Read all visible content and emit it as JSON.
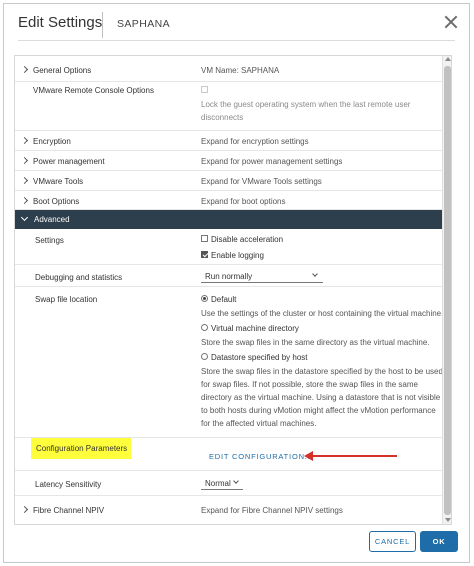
{
  "dialog": {
    "title": "Edit Settings",
    "vm_name": "SAPHANA"
  },
  "rows": {
    "general": {
      "label": "General Options",
      "value": "VM Name: SAPHANA"
    },
    "vmrc": {
      "label": "VMware Remote Console Options",
      "value_line1": "Lock the guest operating system when the last remote user",
      "value_line2": "disconnects"
    },
    "encryption": {
      "label": "Encryption",
      "value": "Expand for encryption settings"
    },
    "power": {
      "label": "Power management",
      "value": "Expand for power management settings"
    },
    "tools": {
      "label": "VMware Tools",
      "value": "Expand for VMware Tools settings"
    },
    "boot": {
      "label": "Boot Options",
      "value": "Expand for boot options"
    }
  },
  "advanced": {
    "label": "Advanced",
    "settings_label": "Settings",
    "disable_acceleration": "Disable acceleration",
    "enable_logging": "Enable logging",
    "debugging_label": "Debugging and statistics",
    "debugging_value": "Run normally",
    "swap_label": "Swap file location",
    "swap_default": "Default",
    "swap_default_desc": "Use the settings of the cluster or host containing the virtual machine.",
    "swap_vmdir": "Virtual machine directory",
    "swap_vmdir_desc": "Store the swap files in the same directory as the virtual machine.",
    "swap_datastore": "Datastore specified by host",
    "swap_ds_line1": "Store the swap files in the datastore specified by the host to be used",
    "swap_ds_line2": "for swap files. If not possible, store the swap files in the same",
    "swap_ds_line3": "directory as the virtual machine. Using a datastore that is not visible",
    "swap_ds_line4": "to both hosts during vMotion might affect the vMotion performance",
    "swap_ds_line5": "for the affected virtual machines.",
    "config_params_label": "Configuration Parameters",
    "edit_configuration": "EDIT CONFIGURATION...",
    "latency_label": "Latency Sensitivity",
    "latency_value": "Normal"
  },
  "fibre": {
    "label": "Fibre Channel NPIV",
    "value": "Expand for Fibre Channel NPIV settings"
  },
  "buttons": {
    "cancel": "CANCEL",
    "ok": "OK"
  },
  "colors": {
    "accent": "#1f6da8",
    "advanced_header": "#2d3e4c",
    "highlight": "#ffff3c",
    "annotation_arrow": "#d6302b"
  }
}
